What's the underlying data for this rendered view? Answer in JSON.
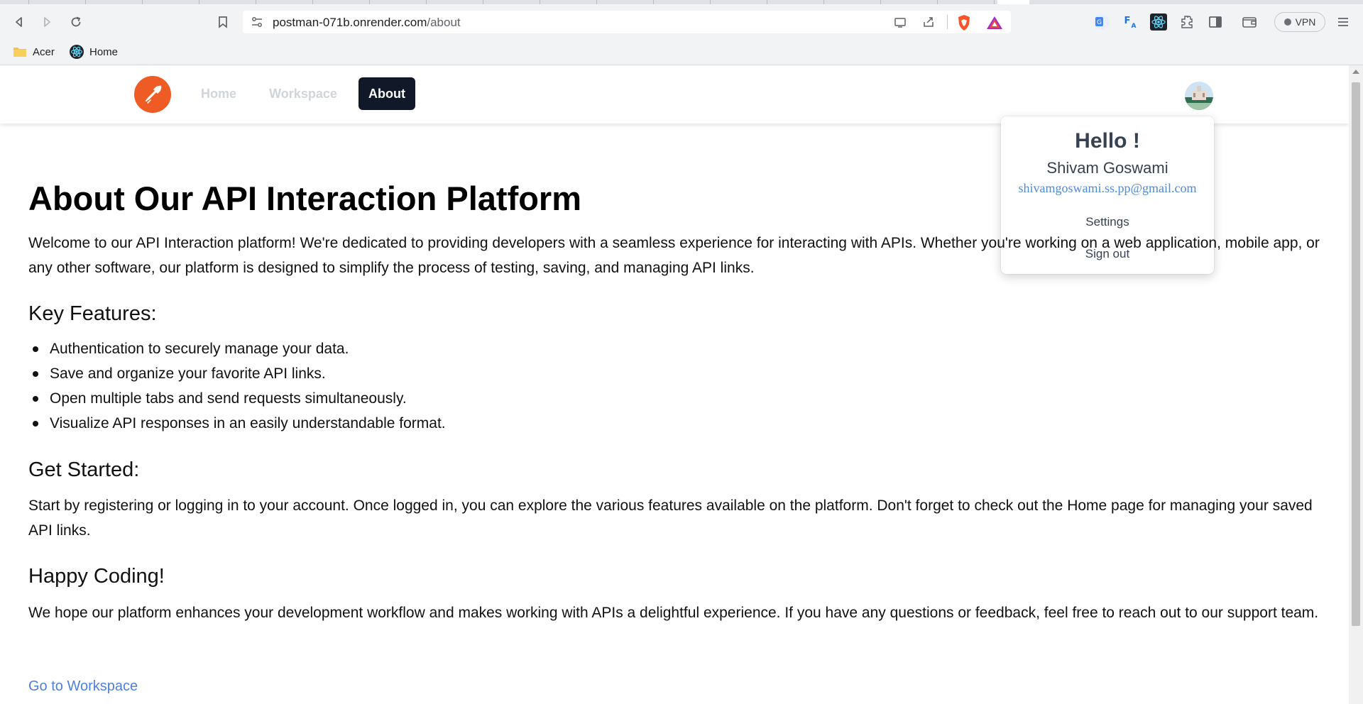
{
  "browser": {
    "url_host": "postman-071b.onrender.com",
    "url_path": "/about",
    "vpn_label": "VPN",
    "bookmarks": [
      {
        "label": "Acer",
        "icon": "folder-icon"
      },
      {
        "label": "Home",
        "icon": "react-icon"
      }
    ]
  },
  "nav": {
    "links": [
      {
        "label": "Home",
        "active": false
      },
      {
        "label": "Workspace",
        "active": false
      },
      {
        "label": "About",
        "active": true
      }
    ]
  },
  "user_menu": {
    "greeting": "Hello !",
    "name": "Shivam Goswami",
    "email": "shivamgoswami.ss.pp@gmail.com",
    "items": [
      "Settings",
      "Sign out"
    ]
  },
  "page": {
    "title": "About Our API Interaction Platform",
    "intro": "Welcome to our API Interaction platform! We're dedicated to providing developers with a seamless experience for interacting with APIs. Whether you're working on a web application, mobile app, or any other software, our platform is designed to simplify the process of testing, saving, and managing API links.",
    "features_heading": "Key Features:",
    "features": [
      "Authentication to securely manage your data.",
      "Save and organize your favorite API links.",
      "Open multiple tabs and send requests simultaneously.",
      "Visualize API responses in an easily understandable format."
    ],
    "get_started_heading": "Get Started:",
    "get_started_text": "Start by registering or logging in to your account. Once logged in, you can explore the various features available on the platform. Don't forget to check out the Home page for managing your saved API links.",
    "happy_heading": "Happy Coding!",
    "happy_text": "We hope our platform enhances your development workflow and makes working with APIs a delightful experience. If you have any questions or feedback, feel free to reach out to our support team.",
    "workspace_link": "Go to Workspace"
  },
  "colors": {
    "brand_orange": "#ef5b25",
    "nav_active_bg": "#111827",
    "link_blue": "#4f7fe0"
  }
}
